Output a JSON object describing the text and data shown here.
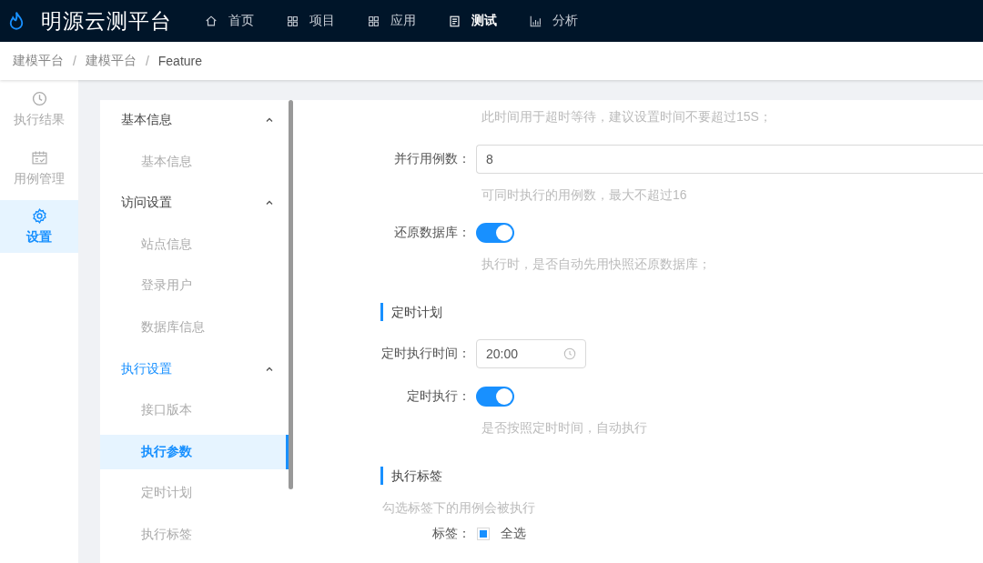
{
  "app": {
    "title": "明源云测平台"
  },
  "top_nav": [
    {
      "label": "首页",
      "selected": false
    },
    {
      "label": "项目",
      "selected": false
    },
    {
      "label": "应用",
      "selected": false
    },
    {
      "label": "测试",
      "selected": true
    },
    {
      "label": "分析",
      "selected": false
    }
  ],
  "breadcrumb": [
    {
      "kind": "link",
      "text": "建模平台"
    },
    {
      "kind": "separator",
      "text": "/"
    },
    {
      "kind": "link",
      "text": "建模平台"
    },
    {
      "kind": "separator",
      "text": "/"
    },
    {
      "kind": "current",
      "text": "Feature"
    }
  ],
  "side_rail": [
    {
      "label": "执行结果",
      "selected": false
    },
    {
      "label": "用例管理",
      "selected": false
    },
    {
      "label": "设置",
      "selected": true
    }
  ],
  "settings_menu": [
    {
      "label": "基本信息",
      "expanded": true,
      "children": [
        {
          "label": "基本信息",
          "selected": false
        }
      ]
    },
    {
      "label": "访问设置",
      "expanded": true,
      "children": [
        {
          "label": "站点信息",
          "selected": false
        },
        {
          "label": "登录用户",
          "selected": false
        },
        {
          "label": "数据库信息",
          "selected": false
        }
      ]
    },
    {
      "label": "执行设置",
      "expanded": true,
      "children": [
        {
          "label": "接口版本",
          "selected": false
        },
        {
          "label": "执行参数",
          "selected": true
        },
        {
          "label": "定时计划",
          "selected": false
        },
        {
          "label": "执行标签",
          "selected": false
        }
      ]
    }
  ],
  "form": [
    {
      "kind": "hint",
      "text": "此时间用于超时等待，建议设置时间不要超过15S；"
    },
    {
      "kind": "input",
      "label": "并行用例数：",
      "value": "8"
    },
    {
      "kind": "hint",
      "text": "可同时执行的用例数，最大不超过16"
    },
    {
      "kind": "switch",
      "label": "还原数据库：",
      "on": true
    },
    {
      "kind": "hint",
      "text": "执行时，是否自动先用快照还原数据库；"
    },
    {
      "kind": "section",
      "text": "定时计划"
    },
    {
      "kind": "time",
      "label": "定时执行时间：",
      "value": "20:00"
    },
    {
      "kind": "switch",
      "label": "定时执行：",
      "on": true
    },
    {
      "kind": "hint",
      "text": "是否按照定时时间，自动执行"
    },
    {
      "kind": "section",
      "text": "执行标签"
    },
    {
      "kind": "note",
      "text": "勾选标签下的用例会被执行"
    },
    {
      "kind": "checkbox",
      "label": "标签：",
      "option": "全选",
      "checked": false,
      "indeterminate": true
    }
  ]
}
